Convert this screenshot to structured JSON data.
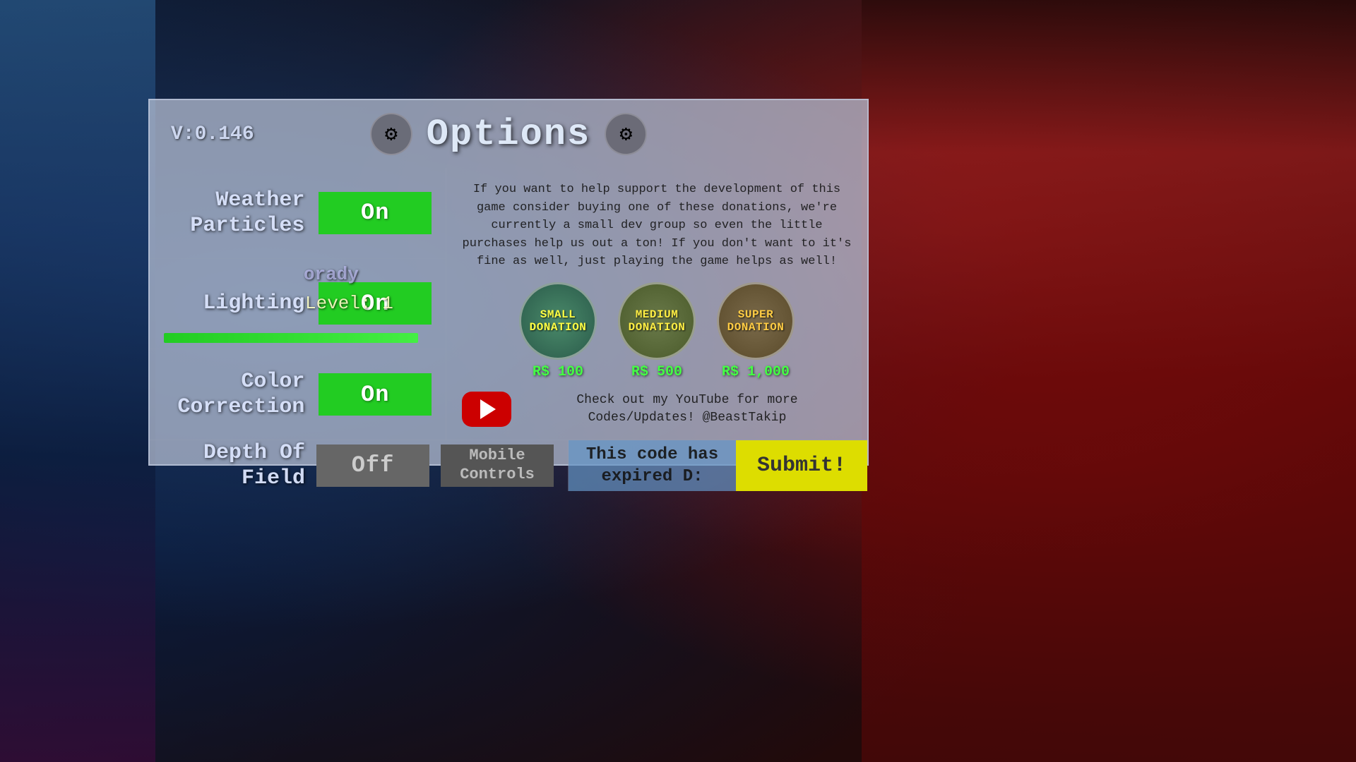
{
  "background": {
    "description": "game scene background"
  },
  "version": {
    "label": "V:0.146"
  },
  "modal": {
    "title": "Options",
    "wrench_icon_1": "⚙",
    "wrench_symbol": "🔧"
  },
  "options": [
    {
      "label": "Weather\nParticles",
      "label_line1": "Weather",
      "label_line2": "Particles",
      "state": "On",
      "is_on": true
    },
    {
      "label": "Lighting",
      "label_line1": "Lighting",
      "label_line2": "",
      "state": "On",
      "is_on": true,
      "level_text": "Level:"
    },
    {
      "label": "Color\nCorrection",
      "label_line1": "Color",
      "label_line2": "Correction",
      "state": "On",
      "is_on": true
    }
  ],
  "depth_of_field": {
    "label_line1": "Depth Of",
    "label_line2": "Field",
    "state": "Off",
    "is_on": false
  },
  "mobile_controls": {
    "label_line1": "Mobile",
    "label_line2": "Controls"
  },
  "support_text": "If you want to help support the development of this game consider buying one of these donations, we're currently a small dev group so even the little purchases help us out a ton! If you don't want to it's fine as well, just playing the game helps as well!",
  "donations": [
    {
      "type": "SMALL",
      "label": "SMALL\nDONATION",
      "price": "R$ 100"
    },
    {
      "type": "MEDIUM",
      "label": "MEDIUM\nDONATION",
      "price": "R$ 500"
    },
    {
      "type": "SUPER",
      "label": "SUPER\nDONATION",
      "price": "R$ 1,000"
    }
  ],
  "youtube": {
    "text": "Check out my YouTube for more Codes/Updates! @BeastTakip"
  },
  "code_section": {
    "expired_text": "This code has expired D:",
    "submit_label": "Submit!"
  },
  "player_name": "orady"
}
